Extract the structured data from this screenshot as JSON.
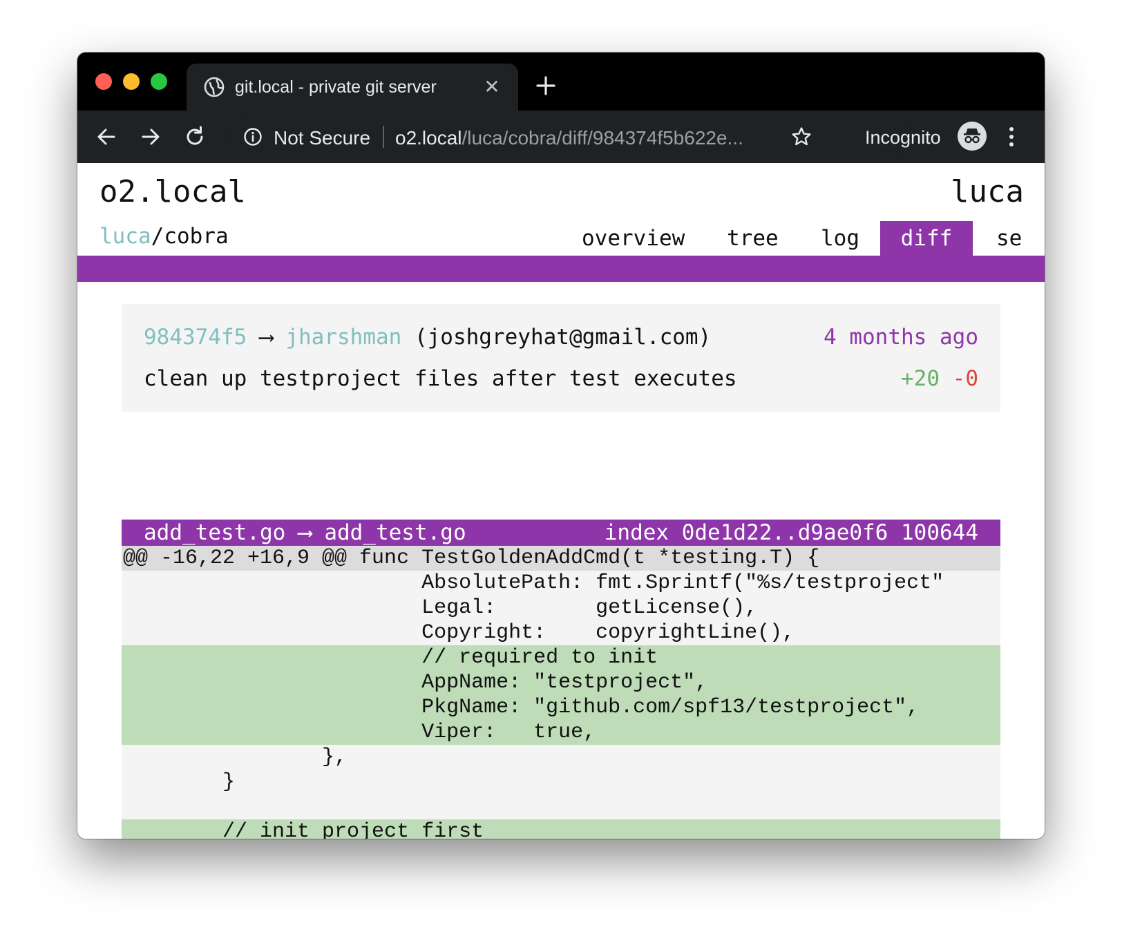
{
  "browser": {
    "tab_title": "git.local - private git server",
    "security_label": "Not Secure",
    "url_host": "o2.local",
    "url_path": "/luca/cobra/diff/984374f5b622e...",
    "incognito_label": "Incognito",
    "icons": {
      "close": "close-icon",
      "new_tab": "plus-icon",
      "back": "arrow-left-icon",
      "forward": "arrow-right-icon",
      "reload": "reload-icon",
      "info": "info-icon",
      "bookmark": "star-icon",
      "incognito": "incognito-icon",
      "menu": "kebab-menu-icon"
    },
    "colors": {
      "close_dot": "#fe5f57",
      "minimize_dot": "#febc2e",
      "maximize_dot": "#28c840"
    }
  },
  "site": {
    "title": "o2.local",
    "user": "luca",
    "repo_owner": "luca",
    "repo_sep": "/",
    "repo_name": "cobra",
    "nav": [
      {
        "label": "overview",
        "active": false
      },
      {
        "label": "tree",
        "active": false
      },
      {
        "label": "log",
        "active": false
      },
      {
        "label": "diff",
        "active": true
      },
      {
        "label": "se",
        "active": false
      }
    ],
    "accent_color": "#8e35a9"
  },
  "commit": {
    "hash": "984374f5",
    "arrow": "⟶",
    "author": "jharshman",
    "email": "(joshgreyhat@gmail.com)",
    "time": "4 months ago",
    "message": "clean up testproject files after test executes",
    "additions": "+20",
    "deletions": "-0"
  },
  "diff": {
    "from_file": "add_test.go",
    "arrow": "⟶",
    "to_file": "add_test.go",
    "index": "index 0de1d22..d9ae0f6 100644",
    "lines": [
      {
        "type": "hunk",
        "text": "@@ -16,22 +16,9 @@ func TestGoldenAddCmd(t *testing.T) {"
      },
      {
        "type": "ctx",
        "text": "                        AbsolutePath: fmt.Sprintf(\"%s/testproject\""
      },
      {
        "type": "ctx",
        "text": "                        Legal:        getLicense(),"
      },
      {
        "type": "ctx",
        "text": "                        Copyright:    copyrightLine(),"
      },
      {
        "type": "add",
        "text": "                        // required to init"
      },
      {
        "type": "add",
        "text": "                        AppName: \"testproject\","
      },
      {
        "type": "add",
        "text": "                        PkgName: \"github.com/spf13/testproject\","
      },
      {
        "type": "add",
        "text": "                        Viper:   true,"
      },
      {
        "type": "ctx",
        "text": "                },"
      },
      {
        "type": "ctx",
        "text": "        }"
      },
      {
        "type": "ctx",
        "text": ""
      },
      {
        "type": "add",
        "text": "        // init project first"
      }
    ]
  }
}
